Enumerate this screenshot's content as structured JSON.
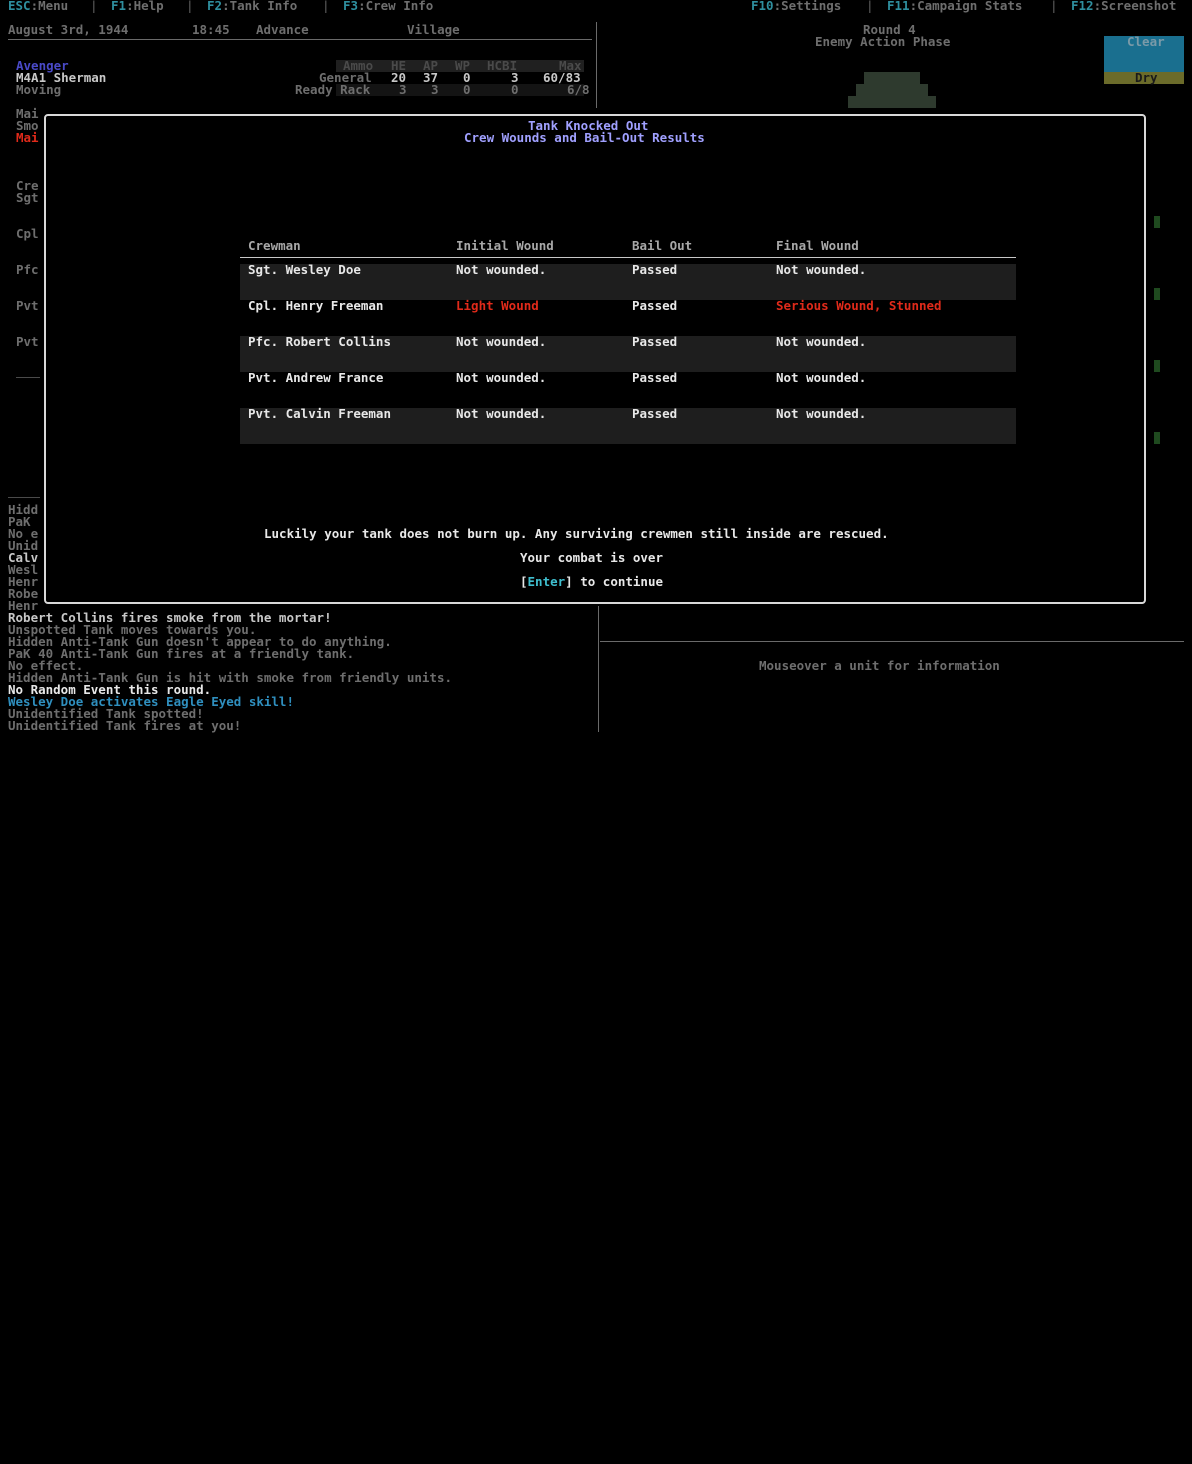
{
  "menu": {
    "esc_key": "ESC",
    "esc_label": ":Menu",
    "f1_key": "F1",
    "f1_label": ":Help",
    "f2_key": "F2",
    "f2_label": ":Tank Info",
    "f3_key": "F3",
    "f3_label": ":Crew Info",
    "f10_key": "F10",
    "f10_label": ":Settings",
    "f11_key": "F11",
    "f11_label": ":Campaign Stats",
    "f12_key": "F12",
    "f12_label": ":Screenshot",
    "separator": "|"
  },
  "status": {
    "date": "August 3rd, 1944",
    "time": "18:45",
    "mission": "Advance",
    "terrain": "Village"
  },
  "tank": {
    "name": "Avenger",
    "model": "M4A1 Sherman",
    "movement": "Moving",
    "ammo_headers": [
      "Ammo",
      "HE",
      "AP",
      "WP",
      "HCBI",
      "Max"
    ],
    "general_label": "General",
    "general": [
      "20",
      "37",
      "0",
      "3",
      "60/83"
    ],
    "ready_label": "Ready Rack",
    "ready": [
      "3",
      "3",
      "0",
      "0",
      "6/8"
    ]
  },
  "side_fragments": [
    "Mai",
    "Smo",
    "Mai",
    "Cre",
    "Sgt",
    "Cpl",
    "Pfc",
    "Pvt",
    "Pvt"
  ],
  "round": {
    "label": "Round 4",
    "phase": "Enemy Action Phase"
  },
  "weather": {
    "sky": "Clear",
    "ground": "Dry",
    "sky_color": "#1a6f8f",
    "ground_color": "#6b6b2a"
  },
  "modal": {
    "title": "Tank Knocked Out",
    "subtitle": "Crew Wounds and Bail-Out Results",
    "columns": [
      "Crewman",
      "Initial Wound",
      "Bail Out",
      "Final Wound"
    ],
    "rows": [
      {
        "name": "Sgt. Wesley Doe",
        "initial": "Not wounded.",
        "bail": "Passed",
        "final": "Not wounded.",
        "initial_alert": false,
        "final_alert": false
      },
      {
        "name": "Cpl. Henry Freeman",
        "initial": "Light Wound",
        "bail": "Passed",
        "final": "Serious Wound, Stunned",
        "initial_alert": true,
        "final_alert": true
      },
      {
        "name": "Pfc. Robert Collins",
        "initial": "Not wounded.",
        "bail": "Passed",
        "final": "Not wounded.",
        "initial_alert": false,
        "final_alert": false
      },
      {
        "name": "Pvt. Andrew France",
        "initial": "Not wounded.",
        "bail": "Passed",
        "final": "Not wounded.",
        "initial_alert": false,
        "final_alert": false
      },
      {
        "name": "Pvt. Calvin Freeman",
        "initial": "Not wounded.",
        "bail": "Passed",
        "final": "Not wounded.",
        "initial_alert": false,
        "final_alert": false
      }
    ],
    "message": "Luckily your tank does not burn up. Any surviving crewmen still inside are rescued.",
    "combat_over": "Your combat is over",
    "enter_open": "[",
    "enter_key": "Enter",
    "enter_close": "]",
    "continue_text": " to continue",
    "alert_color": "#e02a1a"
  },
  "log_fragments": [
    "Hidd",
    "PaK",
    "No e",
    "Unid",
    "Calv",
    "Wesl",
    "Henr",
    "Robe",
    "Henr"
  ],
  "log": [
    {
      "text": "Robert Collins fires smoke from the mortar!",
      "style": "normal"
    },
    {
      "text": "Unspotted Tank moves towards you.",
      "style": "dim"
    },
    {
      "text": "Hidden Anti-Tank Gun doesn't appear to do anything.",
      "style": "dim"
    },
    {
      "text": "PaK 40 Anti-Tank Gun fires at a friendly tank.",
      "style": "dim"
    },
    {
      "text": "No effect.",
      "style": "dim"
    },
    {
      "text": "Hidden Anti-Tank Gun is hit with smoke from friendly units.",
      "style": "dim"
    },
    {
      "text": "No Random Event this round.",
      "style": "normal"
    },
    {
      "text": "Wesley Doe activates Eagle Eyed skill!",
      "style": "skill"
    },
    {
      "text": "Unidentified Tank spotted!",
      "style": "dim"
    },
    {
      "text": "Unidentified Tank fires at you!",
      "style": "dim"
    }
  ],
  "info_panel": {
    "hint": "Mouseover a unit for information"
  }
}
